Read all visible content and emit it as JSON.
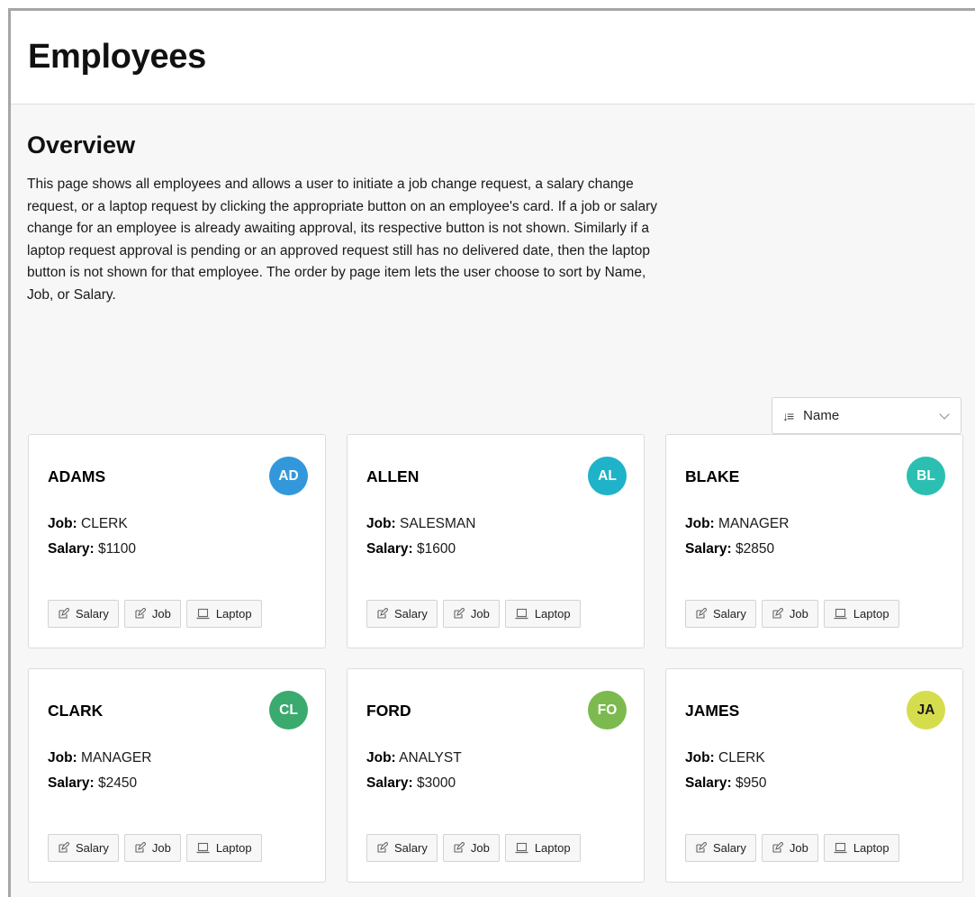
{
  "header": {
    "title": "Employees"
  },
  "overview": {
    "title": "Overview",
    "text": "This page shows all employees and allows a user to initiate a job change request, a salary change request, or a laptop request by clicking the appropriate button on an employee's card. If a job or salary change for an employee is already awaiting approval, its respective button is not shown. Similarly if a laptop request approval is pending or an approved request still has no delivered date, then the laptop button is not shown for that employee. The order by page item lets the user choose to sort by Name, Job, or Salary."
  },
  "sort": {
    "icon": "sort-descending-icon",
    "selected": "Name"
  },
  "labels": {
    "job": "Job:",
    "salary": "Salary:"
  },
  "buttons": {
    "salary": "Salary",
    "job": "Job",
    "laptop": "Laptop"
  },
  "employees": [
    {
      "name": "ADAMS",
      "initials": "AD",
      "job": "CLERK",
      "salary": "$1100",
      "avatar_color": "#3398db"
    },
    {
      "name": "ALLEN",
      "initials": "AL",
      "job": "SALESMAN",
      "salary": "$1600",
      "avatar_color": "#1eb3c9"
    },
    {
      "name": "BLAKE",
      "initials": "BL",
      "job": "MANAGER",
      "salary": "$2850",
      "avatar_color": "#2bbfb1"
    },
    {
      "name": "CLARK",
      "initials": "CL",
      "job": "MANAGER",
      "salary": "$2450",
      "avatar_color": "#3aaa6e"
    },
    {
      "name": "FORD",
      "initials": "FO",
      "job": "ANALYST",
      "salary": "$3000",
      "avatar_color": "#7cba4f"
    },
    {
      "name": "JAMES",
      "initials": "JA",
      "job": "CLERK",
      "salary": "$950",
      "avatar_color": "#d6dd4c"
    }
  ]
}
